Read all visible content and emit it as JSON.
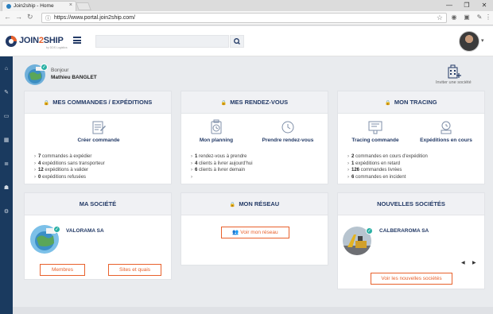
{
  "browser": {
    "tab_title": "Join2ship - Home",
    "tab_close": "×",
    "url": "https://www.portal.join2ship.com/",
    "window_buttons": [
      "—",
      "❐",
      "✕"
    ]
  },
  "header": {
    "logo_main": "JOIN",
    "logo_two": "2",
    "logo_end": "SHIP",
    "logo_sub": "by DDS Logistics",
    "search_placeholder": "",
    "accent_color": "#e8612c",
    "brand_color": "#233a66"
  },
  "welcome": {
    "greeting": "Bonjour",
    "user_name": "Mathieu BANGLET",
    "invite_label": "Inviter une société"
  },
  "cards": {
    "orders": {
      "title": "MES COMMANDES / EXPÉDITIONS",
      "action_label": "Créer commande",
      "stats": [
        {
          "num": "7",
          "text": " commandes à expédier"
        },
        {
          "num": "4",
          "text": " expéditions sans transporteur"
        },
        {
          "num": "12",
          "text": " expéditions à valider"
        },
        {
          "num": "0",
          "text": " expéditions refusées"
        }
      ]
    },
    "appointments": {
      "title": "MES RENDEZ-VOUS",
      "action1_label": "Mon planning",
      "action2_label": "Prendre rendez-vous",
      "stats": [
        {
          "num": "1",
          "text": " rendez-vous à prendre"
        },
        {
          "num": "4",
          "text": " clients à livrer aujourd'hui"
        },
        {
          "num": "6",
          "text": " clients à livrer demain"
        },
        {
          "num": "",
          "text": ""
        }
      ]
    },
    "tracing": {
      "title": "MON TRACING",
      "action1_label": "Tracing commande",
      "action2_label": "Expéditions en cours",
      "stats": [
        {
          "num": "2",
          "text": " commandes en cours d'expédition"
        },
        {
          "num": "1",
          "text": " expéditions en retard"
        },
        {
          "num": "126",
          "text": " commandes livrées"
        },
        {
          "num": "6",
          "text": " commandes en incident"
        }
      ]
    },
    "company": {
      "title": "MA SOCIÉTÉ",
      "company_name": "VALORAMA SA",
      "members_button": "Membres",
      "sites_button": "Sites et quais"
    },
    "network": {
      "title": "MON RÉSEAU",
      "view_button": "Voir mon réseau"
    },
    "new_companies": {
      "title": "NOUVELLES SOCIÉTÉS",
      "company_name": "CALBERAROMA SA",
      "view_button": "Voir les nouvelles sociétés",
      "prev": "◀",
      "next": "▶"
    }
  }
}
